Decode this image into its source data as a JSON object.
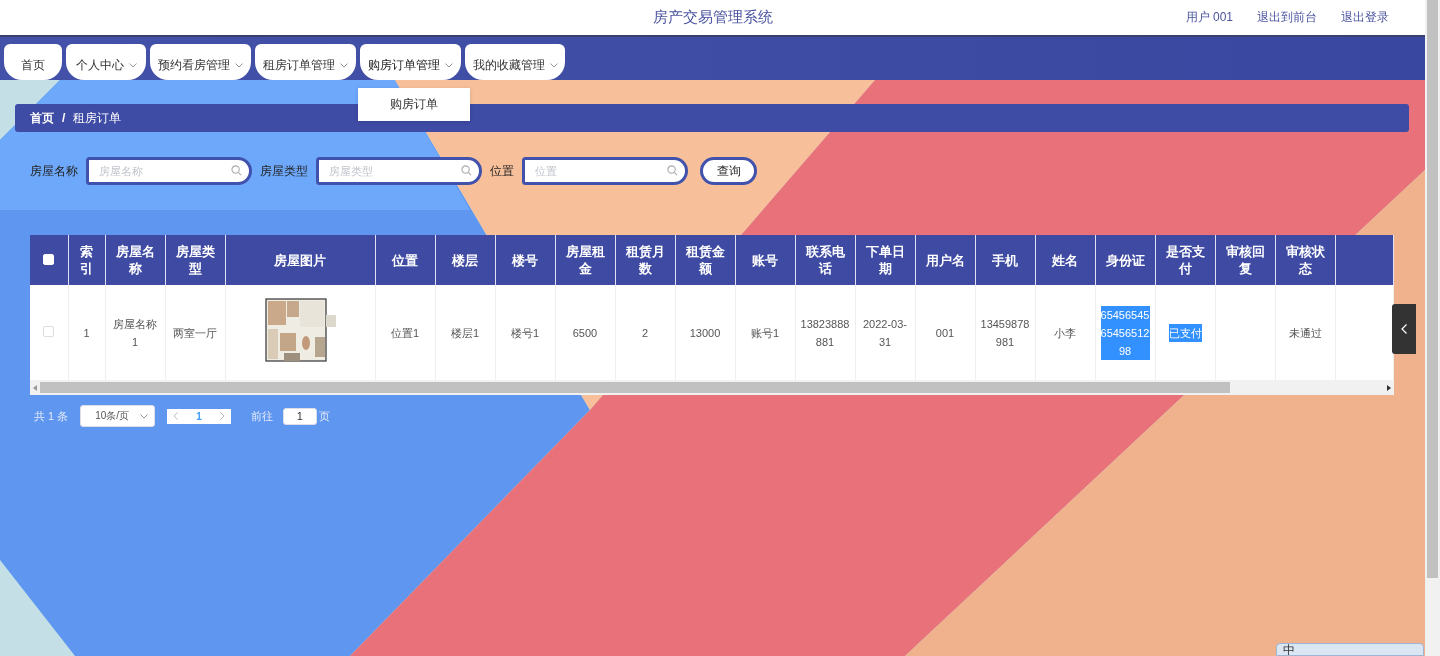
{
  "header": {
    "title": "房产交易管理系统",
    "user_label": "用户",
    "user_name": "001",
    "links": [
      "退出到前台",
      "退出登录"
    ]
  },
  "nav": {
    "tabs": [
      {
        "label": "首页",
        "has_menu": false,
        "selected": false
      },
      {
        "label": "个人中心",
        "has_menu": true,
        "selected": false
      },
      {
        "label": "预约看房管理",
        "has_menu": true,
        "selected": false
      },
      {
        "label": "租房订单管理",
        "has_menu": true,
        "selected": false
      },
      {
        "label": "购房订单管理",
        "has_menu": true,
        "selected": true
      },
      {
        "label": "我的收藏管理",
        "has_menu": true,
        "selected": false
      }
    ],
    "open_menu": {
      "items": [
        "购房订单"
      ]
    }
  },
  "breadcrumb": {
    "items": [
      "首页",
      "租房订单"
    ],
    "separator": "/"
  },
  "search": {
    "fields": [
      {
        "label": "房屋名称",
        "placeholder": "房屋名称"
      },
      {
        "label": "房屋类型",
        "placeholder": "房屋类型"
      },
      {
        "label": "位置",
        "placeholder": "位置"
      }
    ],
    "button": "查询"
  },
  "table": {
    "columns": [
      {
        "kind": "checkbox",
        "checked": false
      },
      {
        "kind": "text",
        "label": "索引"
      },
      {
        "kind": "text",
        "label": "房屋名称"
      },
      {
        "kind": "text",
        "label": "房屋类型"
      },
      {
        "kind": "text",
        "label": "房屋图片"
      },
      {
        "kind": "text",
        "label": "位置"
      },
      {
        "kind": "text",
        "label": "楼层"
      },
      {
        "kind": "text",
        "label": "楼号"
      },
      {
        "kind": "text",
        "label": "房屋租金"
      },
      {
        "kind": "text",
        "label": "租赁月数"
      },
      {
        "kind": "text",
        "label": "租赁金额"
      },
      {
        "kind": "text",
        "label": "账号"
      },
      {
        "kind": "text",
        "label": "联系电话"
      },
      {
        "kind": "text",
        "label": "下单日期"
      },
      {
        "kind": "text",
        "label": "用户名"
      },
      {
        "kind": "text",
        "label": "手机"
      },
      {
        "kind": "text",
        "label": "姓名"
      },
      {
        "kind": "text",
        "label": "身份证"
      },
      {
        "kind": "text",
        "label": "是否支付"
      },
      {
        "kind": "text",
        "label": "审核回复"
      },
      {
        "kind": "text",
        "label": "审核状态"
      }
    ],
    "rows": [
      {
        "cells": [
          {
            "kind": "checkbox",
            "checked": false
          },
          {
            "kind": "text",
            "text": "1",
            "selected": false
          },
          {
            "kind": "text",
            "text": "房屋名称1",
            "selected": false
          },
          {
            "kind": "text",
            "text": "两室一厅",
            "selected": false
          },
          {
            "kind": "picture"
          },
          {
            "kind": "text",
            "text": "位置1",
            "selected": false
          },
          {
            "kind": "text",
            "text": "楼层1",
            "selected": false
          },
          {
            "kind": "text",
            "text": "楼号1",
            "selected": false
          },
          {
            "kind": "text",
            "text": "6500",
            "selected": false
          },
          {
            "kind": "text",
            "text": "2",
            "selected": false
          },
          {
            "kind": "text",
            "text": "13000",
            "selected": false
          },
          {
            "kind": "text",
            "text": "账号1",
            "selected": false
          },
          {
            "kind": "text",
            "text": "13823888881",
            "selected": false
          },
          {
            "kind": "text",
            "text": "2022-03-31",
            "selected": false
          },
          {
            "kind": "text",
            "text": "001",
            "selected": false
          },
          {
            "kind": "text",
            "text": "13459878981",
            "selected": false
          },
          {
            "kind": "text",
            "text": "小李",
            "selected": false
          },
          {
            "kind": "text",
            "text": "654565456545651298",
            "selected": true
          },
          {
            "kind": "text",
            "text": "已支付",
            "selected": true
          },
          {
            "kind": "empty"
          },
          {
            "kind": "text",
            "text": "未通过",
            "selected": false
          }
        ]
      }
    ]
  },
  "pagination": {
    "total_prefix": "共",
    "total": "1",
    "total_suffix": "条",
    "page_size": "10条/页",
    "current_page": "1",
    "goto_label": "前往",
    "goto_value": "1",
    "goto_suffix": "页"
  },
  "ime_bar": {
    "mode": "中"
  }
}
